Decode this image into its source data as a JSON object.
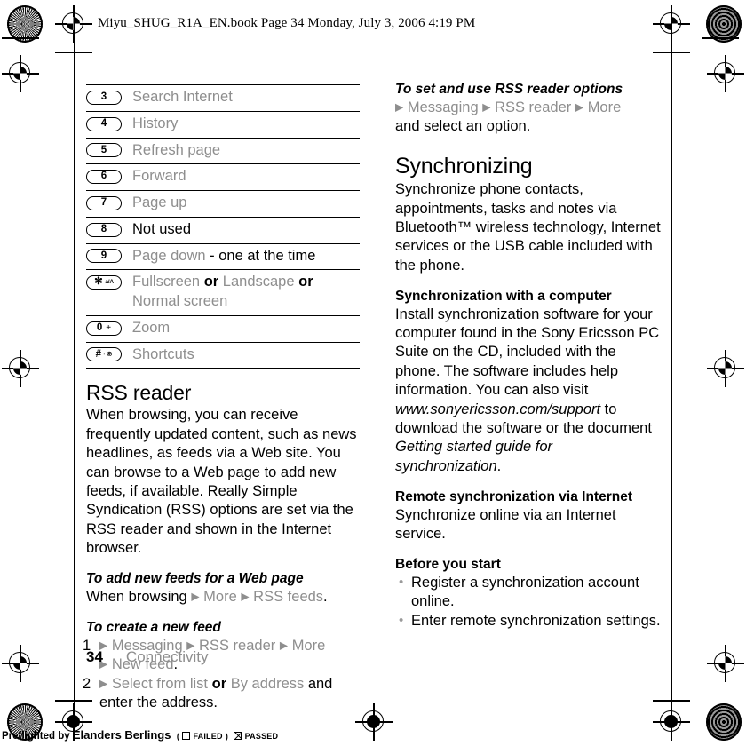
{
  "header": {
    "text": "Miyu_SHUG_R1A_EN.book  Page 34  Monday, July 3, 2006  4:19 PM"
  },
  "key_table": {
    "rows": [
      {
        "key": "3",
        "key_sup": "",
        "parts": [
          {
            "t": "Search Internet",
            "s": "g"
          }
        ]
      },
      {
        "key": "4",
        "key_sup": "",
        "parts": [
          {
            "t": "History",
            "s": "g"
          }
        ]
      },
      {
        "key": "5",
        "key_sup": "",
        "parts": [
          {
            "t": "Refresh page",
            "s": "g"
          }
        ]
      },
      {
        "key": "6",
        "key_sup": "",
        "parts": [
          {
            "t": "Forward",
            "s": "g"
          }
        ]
      },
      {
        "key": "7",
        "key_sup": "",
        "parts": [
          {
            "t": "Page up",
            "s": "g"
          }
        ]
      },
      {
        "key": "8",
        "key_sup": "",
        "parts": [
          {
            "t": "Not used",
            "s": "k"
          }
        ]
      },
      {
        "key": "9",
        "key_sup": "",
        "parts": [
          {
            "t": "Page down",
            "s": "g"
          },
          {
            "t": " - one at the time",
            "s": "k"
          }
        ]
      },
      {
        "key": "✻",
        "key_sup": "a/A",
        "parts": [
          {
            "t": "Fullscreen",
            "s": "g"
          },
          {
            "t": " or ",
            "s": "b"
          },
          {
            "t": "Landscape",
            "s": "g"
          },
          {
            "t": " or ",
            "s": "b"
          },
          {
            "t": "Normal screen",
            "s": "g"
          }
        ]
      },
      {
        "key": "0",
        "key_sup": "+",
        "parts": [
          {
            "t": "Zoom",
            "s": "g"
          }
        ]
      },
      {
        "key": "#",
        "key_sup": "⌐ぁ",
        "parts": [
          {
            "t": "Shortcuts",
            "s": "g"
          }
        ]
      }
    ]
  },
  "left_column": {
    "rss_heading": "RSS reader",
    "rss_body": "When browsing, you can receive frequently updated content, such as news headlines, as feeds via a Web site. You can browse to a Web page to add new feeds, if available. Really Simple Syndication (RSS) options are set via the RSS reader and shown in the Internet browser.",
    "task_add_feeds": {
      "title": "To add new feeds for a Web page",
      "lead": "When browsing",
      "steps": [
        "More",
        "RSS feeds"
      ],
      "trailing": "."
    },
    "task_create_feed": {
      "title": "To create a new feed",
      "step1_num": "1",
      "step1_items": [
        "Messaging",
        "RSS reader",
        "More",
        "New feed"
      ],
      "step1_trailing": ".",
      "step2_num": "2",
      "step2_a": "Select from list",
      "step2_or": " or ",
      "step2_b": "By address",
      "step2_tail": " and enter the address."
    }
  },
  "right_column": {
    "task_rss_options": {
      "title": "To set and use RSS reader options",
      "items": [
        "Messaging",
        "RSS reader",
        "More"
      ],
      "trailing": "and select an option."
    },
    "sync_heading": "Synchronizing",
    "sync_body": "Synchronize phone contacts, appointments, tasks and notes via Bluetooth™ wireless technology, Internet services or the USB cable included with the phone.",
    "sync_computer": {
      "title": "Synchronization with a computer",
      "body_1": "Install synchronization software for your computer found in the Sony Ericsson PC Suite on the CD, included with the phone. The software includes help information. You can also visit ",
      "url": "www.sonyericsson.com/support",
      "body_2": " to download the software or the document ",
      "doc_title": "Getting started guide for synchronization",
      "body_3": "."
    },
    "sync_remote": {
      "title": "Remote synchronization via Internet",
      "body": "Synchronize online via an Internet service."
    },
    "before_you_start": {
      "title": "Before you start",
      "bullets": [
        "Register a synchronization account online.",
        "Enter remote synchronization settings."
      ]
    }
  },
  "footer": {
    "page_number": "34",
    "category": "Connectivity"
  },
  "preflight": {
    "prefix": "Preflighted by",
    "brand": "Elanders Berlings",
    "open_paren": "(",
    "failed_label": "FAILED",
    "close_paren": ")",
    "passed_label": "PASSED"
  }
}
